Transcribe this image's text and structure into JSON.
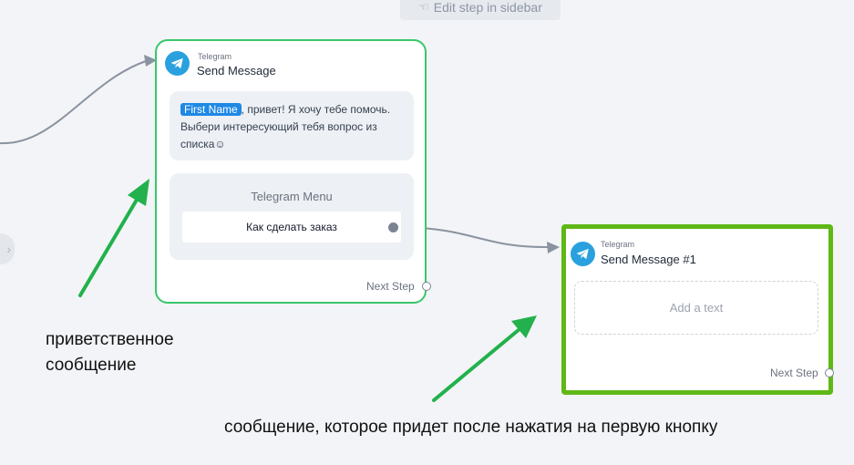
{
  "toolbar": {
    "edit_step_label": "Edit step in sidebar"
  },
  "card1": {
    "platform": "Telegram",
    "title": "Send Message",
    "message": {
      "name_tag": "First Name",
      "text_line1_rest": ", привет! Я хочу тебе помочь.",
      "text_line2": "Выбери интересующий тебя вопрос из",
      "text_line3": "списка☺"
    },
    "menu": {
      "title": "Telegram Menu",
      "buttons": [
        "Как сделать заказ"
      ]
    },
    "next_step_label": "Next Step"
  },
  "card2": {
    "platform": "Telegram",
    "title": "Send Message #1",
    "placeholder": "Add a text",
    "next_step_label": "Next Step"
  },
  "annotations": {
    "caption1_line1": "приветственное",
    "caption1_line2": "сообщение",
    "caption2": "сообщение, которое придет после нажатия на первую кнопку"
  },
  "colors": {
    "active_border": "#38c76a",
    "highlight_border": "#5fb816",
    "telegram_blue": "#2aa1de",
    "name_tag": "#1e88e5",
    "arrow_green": "#22b14c"
  }
}
